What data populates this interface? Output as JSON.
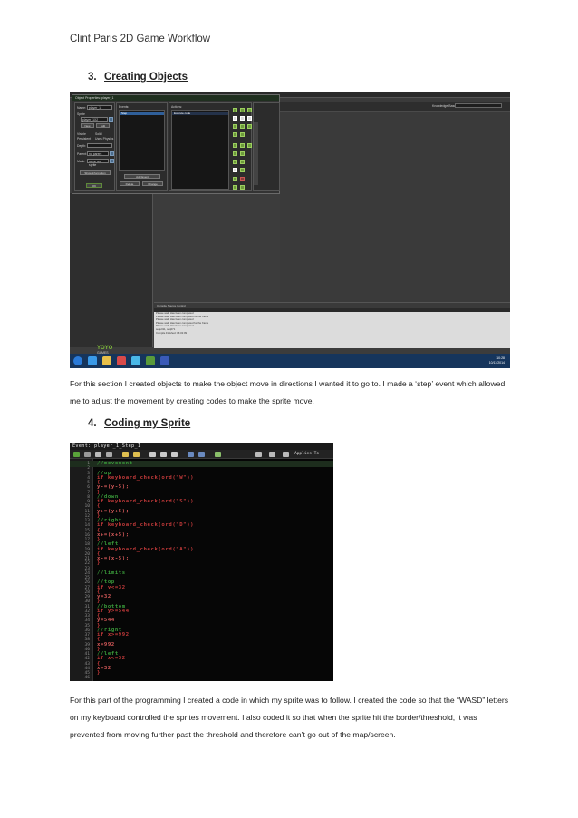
{
  "header": {
    "text": "Clint Paris 2D Game Workflow"
  },
  "section3": {
    "number": "3.",
    "title": "Creating Objects"
  },
  "para1": "For this section I created objects to make the object move in directions I wanted it to go to. I made a ‘step’ event which allowed me to adjust the movement by creating codes to make the sprite move.",
  "section4": {
    "number": "4.",
    "title": "Coding my Sprite"
  },
  "para2": "For this part of the programming I created a code in which my sprite was to follow. I created the code so that the “WASD” letters on my keyboard controlled the sprites movement. I also coded it so that when the sprite hit the border/threshold, it was prevented from moving further past the threshold and therefore can’t go out of the map/screen.",
  "screenshot1": {
    "window_title": "Object Properties: player_1",
    "name_label": "Name:",
    "name_value": "player_1",
    "sprite_label": "Sprite",
    "sprite_value": "player_1X2",
    "new_button": "New",
    "edit_button": "Edit",
    "visible_label": "Visible",
    "solid_label": "Solid",
    "persistent_label": "Persistent",
    "uses_physics_label": "Uses Physics",
    "depth_label": "Depth:",
    "parent_label": "Parent:",
    "parent_value": "no parent",
    "mask_label": "Mask:",
    "mask_value": "same as sprite",
    "show_info_button": "Show Information",
    "ok_button": "OK",
    "events_label": "Events:",
    "event_item": "Step",
    "add_event_button": "Add Event",
    "delete_button": "Delete",
    "change_button": "Change",
    "actions_label": "Actions:",
    "action_item": "Execute code",
    "knowledge_label": "Knowledge Base",
    "compile_tabs": "Compile   Source Control",
    "compile_lines": [
      "Please wait! Has been completed",
      "Please wait! Has been completed for the frame",
      "Please wait! Has been completed",
      "Please wait! Has been completed for the frame",
      "Please wait! Has been completed",
      "",
      "sequ011, seq071",
      "Compile Finished: 16:32:09"
    ],
    "logo_line1": "YOYO",
    "logo_line2": "GAMES",
    "clock_time": "10:28",
    "clock_date": "10/11/2014"
  },
  "screenshot2": {
    "title": "Event: player_1_Step_1",
    "applies_to": "Applies To",
    "lines": [
      {
        "n": "1",
        "code": "//movement",
        "type": "comment"
      },
      {
        "n": "2",
        "code": "",
        "type": "plain"
      },
      {
        "n": "3",
        "code": "//up",
        "type": "comment"
      },
      {
        "n": "4",
        "code": "if keyboard_check(ord(\"W\"))",
        "type": "kw"
      },
      {
        "n": "5",
        "code": "{",
        "type": "brace"
      },
      {
        "n": "6",
        "code": "y-=(y-5);",
        "type": "plain"
      },
      {
        "n": "7",
        "code": "}",
        "type": "brace"
      },
      {
        "n": "8",
        "code": "//down",
        "type": "comment"
      },
      {
        "n": "9",
        "code": "if keyboard_check(ord(\"S\"))",
        "type": "kw"
      },
      {
        "n": "10",
        "code": "{",
        "type": "brace"
      },
      {
        "n": "11",
        "code": "y+=(y+5);",
        "type": "plain"
      },
      {
        "n": "12",
        "code": "}",
        "type": "brace"
      },
      {
        "n": "13",
        "code": "//right",
        "type": "comment"
      },
      {
        "n": "14",
        "code": "if keyboard_check(ord(\"D\"))",
        "type": "kw"
      },
      {
        "n": "15",
        "code": "{",
        "type": "brace"
      },
      {
        "n": "16",
        "code": "x+=(x+5);",
        "type": "plain"
      },
      {
        "n": "17",
        "code": "}",
        "type": "brace"
      },
      {
        "n": "18",
        "code": "//left",
        "type": "comment"
      },
      {
        "n": "19",
        "code": "if keyboard_check(ord(\"A\"))",
        "type": "kw"
      },
      {
        "n": "20",
        "code": "{",
        "type": "brace"
      },
      {
        "n": "21",
        "code": "x-=(x-5);",
        "type": "plain"
      },
      {
        "n": "22",
        "code": "}",
        "type": "brace"
      },
      {
        "n": "23",
        "code": "",
        "type": "plain"
      },
      {
        "n": "24",
        "code": "//limits",
        "type": "comment"
      },
      {
        "n": "25",
        "code": "",
        "type": "plain"
      },
      {
        "n": "26",
        "code": "//top",
        "type": "comment"
      },
      {
        "n": "27",
        "code": "if y<=32",
        "type": "kw"
      },
      {
        "n": "28",
        "code": "{",
        "type": "brace"
      },
      {
        "n": "29",
        "code": "y=32",
        "type": "plain"
      },
      {
        "n": "30",
        "code": "}",
        "type": "brace"
      },
      {
        "n": "31",
        "code": "//bottom",
        "type": "comment"
      },
      {
        "n": "32",
        "code": "if y>=544",
        "type": "kw"
      },
      {
        "n": "33",
        "code": "{",
        "type": "brace"
      },
      {
        "n": "34",
        "code": "y=544",
        "type": "plain"
      },
      {
        "n": "35",
        "code": "}",
        "type": "brace"
      },
      {
        "n": "36",
        "code": "//right",
        "type": "comment"
      },
      {
        "n": "37",
        "code": "if x>=992",
        "type": "kw"
      },
      {
        "n": "38",
        "code": "{",
        "type": "brace"
      },
      {
        "n": "39",
        "code": "x=992",
        "type": "plain"
      },
      {
        "n": "40",
        "code": "}",
        "type": "brace"
      },
      {
        "n": "41",
        "code": "//left",
        "type": "comment"
      },
      {
        "n": "42",
        "code": "if x<=32",
        "type": "kw"
      },
      {
        "n": "43",
        "code": "{",
        "type": "brace"
      },
      {
        "n": "44",
        "code": "x=32",
        "type": "plain"
      },
      {
        "n": "45",
        "code": "}",
        "type": "brace"
      },
      {
        "n": "46",
        "code": "",
        "type": "plain"
      }
    ]
  },
  "colors": {
    "comment": "#3a9a3a",
    "keyword": "#c23a3a",
    "taskbar": "#16355c",
    "accent_green": "#6d9a3c"
  }
}
